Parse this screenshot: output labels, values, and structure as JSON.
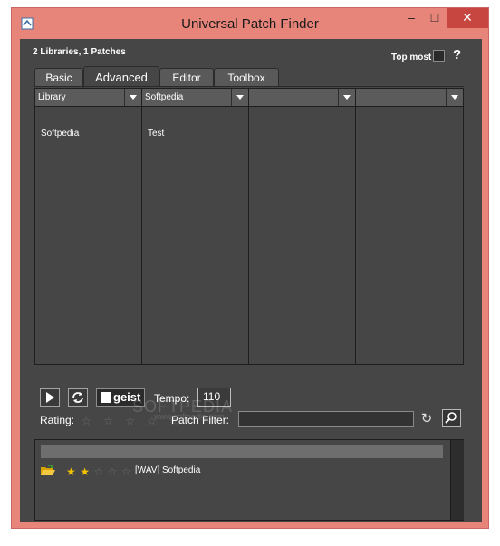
{
  "window": {
    "title": "Universal Patch Finder",
    "controls": {
      "minimize": "–",
      "maximize": "□",
      "close": "✕"
    }
  },
  "header": {
    "status": "2 Libraries, 1 Patches",
    "topmost_label": "Top most",
    "topmost_checked": false,
    "help": "?"
  },
  "tabs": [
    {
      "label": "Basic",
      "active": false
    },
    {
      "label": "Advanced",
      "active": true
    },
    {
      "label": "Editor",
      "active": false
    },
    {
      "label": "Toolbox",
      "active": false
    }
  ],
  "columns": [
    {
      "header": "Library",
      "items": [
        "Softpedia"
      ]
    },
    {
      "header": "Softpedia",
      "items": [
        "Test"
      ]
    },
    {
      "header": "",
      "items": []
    },
    {
      "header": "",
      "items": []
    }
  ],
  "transport": {
    "play_icon": "play-icon",
    "loop_icon": "loop-icon",
    "logo_text": "geist",
    "tempo_label": "Tempo:",
    "tempo_value": "110"
  },
  "filters": {
    "rating_label": "Rating:",
    "rating_value": 0,
    "rating_max": 5,
    "patch_filter_label": "Patch Filter:",
    "patch_filter_value": ""
  },
  "results": [
    {
      "name": "[WAV] Softpedia",
      "rating": 2,
      "rating_max": 5
    }
  ],
  "watermark": {
    "text": "SOFTPEDIA",
    "sub": "www.softpedia.com"
  },
  "colors": {
    "titlebar": "#e8857b",
    "panel": "#464646",
    "close": "#c74640",
    "star": "#f2c100"
  }
}
